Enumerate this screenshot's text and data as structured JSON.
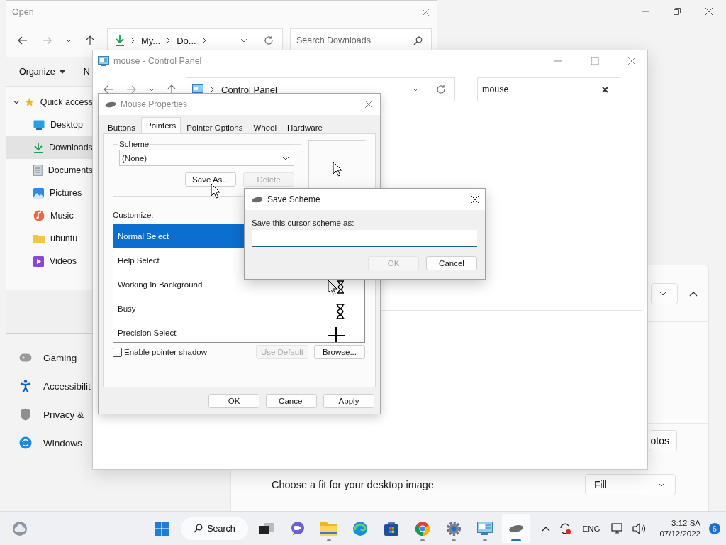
{
  "settings": {
    "nav": [
      {
        "label": "Gaming",
        "kind": "gaming"
      },
      {
        "label": "Accessibilit",
        "kind": "accessibility"
      },
      {
        "label": "Privacy &",
        "kind": "privacy"
      },
      {
        "label": "Windows",
        "kind": "update"
      }
    ],
    "photos_button": "otos",
    "fit_label": "Choose a fit for your desktop image",
    "fit_value": "Fill"
  },
  "open_dialog": {
    "title": "Open",
    "address": [
      "My...",
      "Do..."
    ],
    "search_placeholder": "Search Downloads",
    "toolbar": [
      "Organize",
      "N"
    ],
    "tree": [
      {
        "label": "Quick access",
        "kind": "star",
        "expanded": true,
        "selected": false,
        "children": [
          {
            "label": "Desktop",
            "kind": "desktop",
            "selected": false
          },
          {
            "label": "Downloads",
            "kind": "download",
            "selected": true
          },
          {
            "label": "Documents",
            "kind": "documents",
            "selected": false
          },
          {
            "label": "Pictures",
            "kind": "pictures",
            "selected": false
          },
          {
            "label": "Music",
            "kind": "music",
            "selected": false
          },
          {
            "label": "ubuntu",
            "kind": "folder",
            "selected": false
          },
          {
            "label": "Videos",
            "kind": "videos",
            "selected": false
          }
        ]
      }
    ]
  },
  "control_panel": {
    "title": "mouse - Control Panel",
    "address": "Control Panel",
    "search_value": "mouse"
  },
  "mouse_properties": {
    "title": "Mouse Properties",
    "tabs": [
      {
        "label": "Buttons",
        "selected": false
      },
      {
        "label": "Pointers",
        "selected": true
      },
      {
        "label": "Pointer Options",
        "selected": false
      },
      {
        "label": "Wheel",
        "selected": false
      },
      {
        "label": "Hardware",
        "selected": false
      }
    ],
    "scheme_label": "Scheme",
    "scheme_value": "(None)",
    "save_as": "Save As...",
    "delete": {
      "label": "Delete",
      "disabled": true
    },
    "customize_label": "Customize:",
    "cursors": [
      {
        "name": "Normal Select",
        "selected": true
      },
      {
        "name": "Help Select",
        "selected": false
      },
      {
        "name": "Working In Background",
        "selected": false,
        "kind": "working"
      },
      {
        "name": "Busy",
        "selected": false,
        "kind": "busy"
      },
      {
        "name": "Precision Select",
        "selected": false,
        "kind": "cross"
      }
    ],
    "pointer_shadow": {
      "label": "Enable pointer shadow",
      "checked": false
    },
    "use_default": {
      "label": "Use Default",
      "disabled": true
    },
    "browse": "Browse...",
    "buttons": [
      "OK",
      "Cancel",
      "Apply"
    ]
  },
  "save_scheme": {
    "title": "Save Scheme",
    "prompt": "Save this cursor scheme as:",
    "ok": {
      "label": "OK",
      "disabled": true
    },
    "cancel": "Cancel"
  },
  "taskbar": {
    "search": "Search",
    "apps": [
      {
        "kind": "taskview",
        "running": false,
        "active": false
      },
      {
        "kind": "chat",
        "running": false,
        "active": false
      },
      {
        "kind": "explorer",
        "running": true,
        "active": false
      },
      {
        "kind": "edge",
        "running": false,
        "active": false
      },
      {
        "kind": "store",
        "running": false,
        "active": false
      },
      {
        "kind": "chrome",
        "running": true,
        "active": false
      },
      {
        "kind": "settings",
        "running": true,
        "active": false
      },
      {
        "kind": "controlpanel",
        "running": true,
        "active": false
      },
      {
        "kind": "mouse",
        "running": true,
        "active": true
      }
    ],
    "language": "ENG",
    "time": "3:12 SA",
    "date": "07/12/2022",
    "badge": "6"
  }
}
